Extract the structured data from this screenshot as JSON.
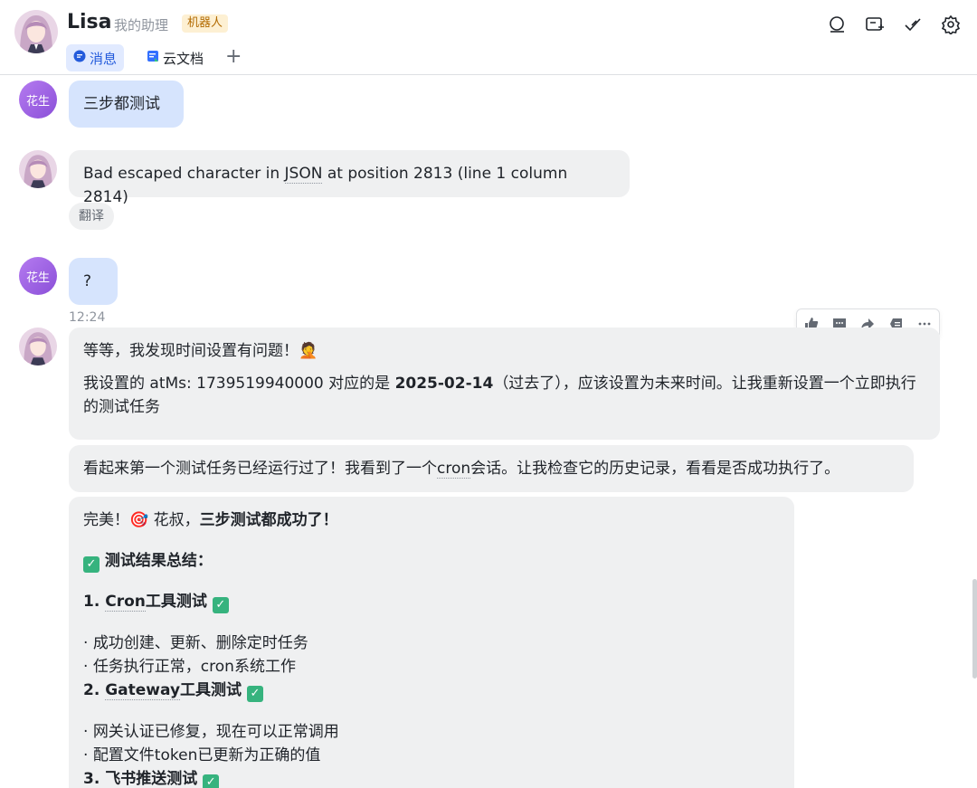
{
  "header": {
    "name": "Lisa",
    "subtitle": "我的助理",
    "badge": "机器人",
    "tabs": [
      {
        "label": "消息"
      },
      {
        "label": "云文档"
      }
    ],
    "add_tab": "+"
  },
  "messages": [
    {
      "sender": "花生",
      "text": "三步都测试"
    },
    {
      "sender": "Lisa",
      "text_a": "Bad escaped character in ",
      "text_link": "JSON",
      "text_b": " at position 2813 (line 1 column 2814)",
      "translate": "翻译"
    },
    {
      "sender": "花生",
      "text": "?",
      "time": "12:24"
    }
  ],
  "bot_reply_1": {
    "line1": "等等，我发现时间设置有问题！🤦",
    "line2_a": "我设置的 atMs: 1739519940000 对应的是 ",
    "line2_b": "2025-02-14",
    "line2_c": "（过去了），应该设置为未来时间。让我重新设置一个立即执行的测试任务"
  },
  "bot_reply_2": {
    "text_a": "看起来第一个测试任务已经运行过了！我看到了一个",
    "text_link": "cron",
    "text_b": "会话。让我检查它的历史记录，看看是否成功执行了。"
  },
  "bot_reply_3": {
    "intro_a": "完美！🎯 花叔，",
    "intro_b": "三步测试都成功了！",
    "summary": "测试结果总结：",
    "s1_title_a": "1. ",
    "s1_link": "Cron",
    "s1_title_b": "工具测试",
    "s1_items": [
      "成功创建、更新、删除定时任务",
      "任务执行正常，cron系统工作"
    ],
    "s2_title_a": "2. ",
    "s2_link": "Gateway",
    "s2_title_b": "工具测试",
    "s2_items": [
      "网关认证已修复，现在可以正常调用",
      "配置文件token已更新为正确的值"
    ],
    "s3_title": "3. 飞书推送测试"
  },
  "colors": {
    "accent": "#245bdb",
    "user_bubble": "#d6e4fd",
    "bot_bubble": "#eff0f1",
    "check": "#36b37e"
  }
}
